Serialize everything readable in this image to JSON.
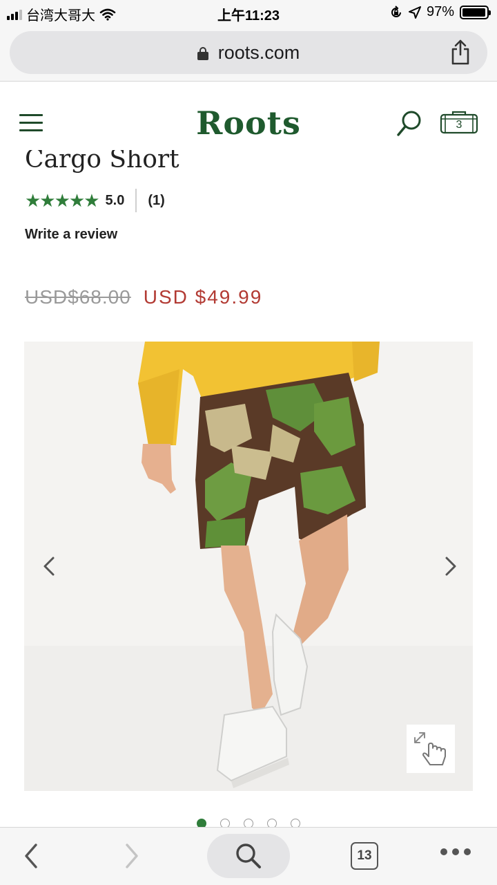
{
  "status_bar": {
    "carrier": "台湾大哥大",
    "time": "上午11:23",
    "battery_percent_label": "97%",
    "battery_level": 0.97
  },
  "browser": {
    "url": "roots.com"
  },
  "header": {
    "logo_text": "Roots",
    "bag_count": "3",
    "brand_color": "#1f5a2e"
  },
  "product": {
    "title_partial": "Cargo Short",
    "rating_stars": "★★★★★",
    "rating_value": "5.0",
    "review_count": "(1)",
    "write_review_label": "Write a review",
    "original_price": "USD$68.00",
    "sale_price": "USD $49.99",
    "sale_color": "#b23a33",
    "rating_color": "#2f7d3a"
  },
  "gallery": {
    "image_name": "camo-cargo-shorts-photo",
    "slide_count": 5,
    "active_slide": 1
  },
  "toolbar": {
    "tabs_count": "13"
  }
}
